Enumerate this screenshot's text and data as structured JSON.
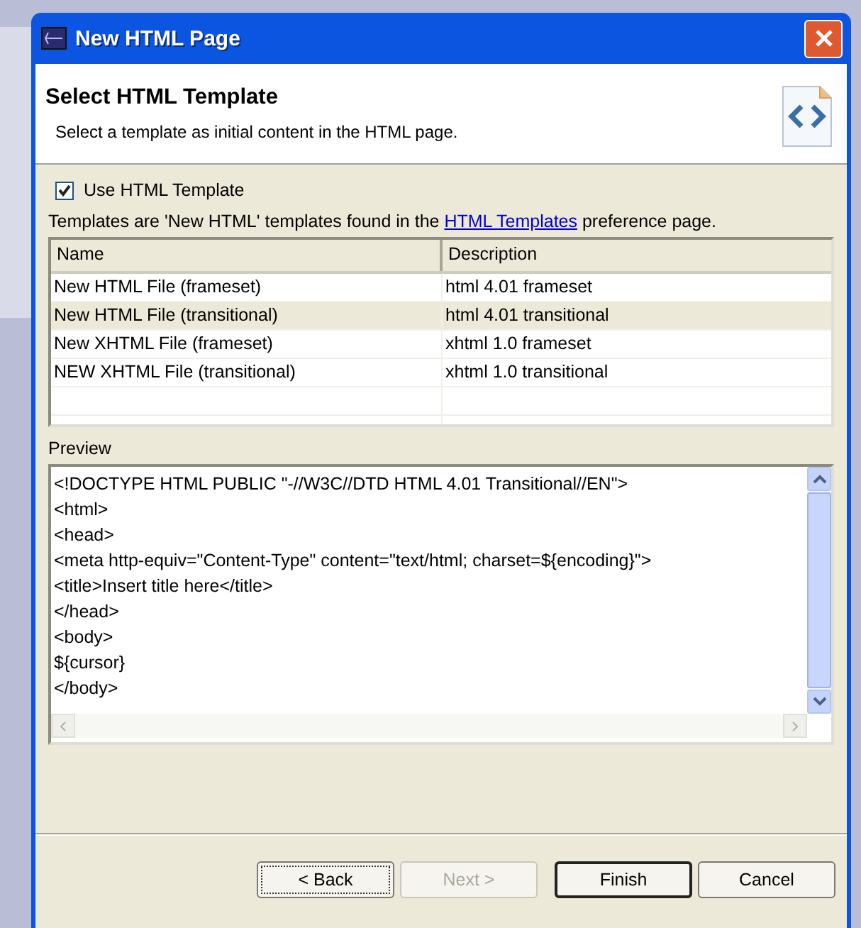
{
  "window": {
    "title": "New HTML Page"
  },
  "header": {
    "title": "Select HTML Template",
    "description": "Select a template as initial content in the HTML page."
  },
  "use_template": {
    "label": "Use HTML Template",
    "checked": true
  },
  "info": {
    "before": "Templates are 'New HTML' templates found in the ",
    "link": "HTML Templates",
    "after": " preference page."
  },
  "table": {
    "columns": [
      "Name",
      "Description"
    ],
    "rows": [
      {
        "name": "New HTML File (frameset)",
        "description": "html 4.01 frameset",
        "selected": false
      },
      {
        "name": "New HTML File (transitional)",
        "description": "html 4.01 transitional",
        "selected": true
      },
      {
        "name": "New XHTML File (frameset)",
        "description": "xhtml 1.0 frameset",
        "selected": false
      },
      {
        "name": "NEW XHTML File (transitional)",
        "description": "xhtml 1.0 transitional",
        "selected": false
      }
    ]
  },
  "preview": {
    "label": "Preview",
    "lines": [
      "<!DOCTYPE HTML PUBLIC \"-//W3C//DTD HTML 4.01 Transitional//EN\">",
      "<html>",
      "<head>",
      "<meta http-equiv=\"Content-Type\" content=\"text/html; charset=${encoding}\">",
      "<title>Insert title here</title>",
      "</head>",
      "<body>",
      "${cursor}",
      "</body>"
    ]
  },
  "buttons": [
    {
      "label": "< Back",
      "disabled": false,
      "focused": true,
      "default": false
    },
    {
      "label": "Next >",
      "disabled": true,
      "focused": false,
      "default": false
    },
    {
      "label": "Finish",
      "disabled": false,
      "focused": false,
      "default": true
    },
    {
      "label": "Cancel",
      "disabled": false,
      "focused": false,
      "default": false
    }
  ]
}
